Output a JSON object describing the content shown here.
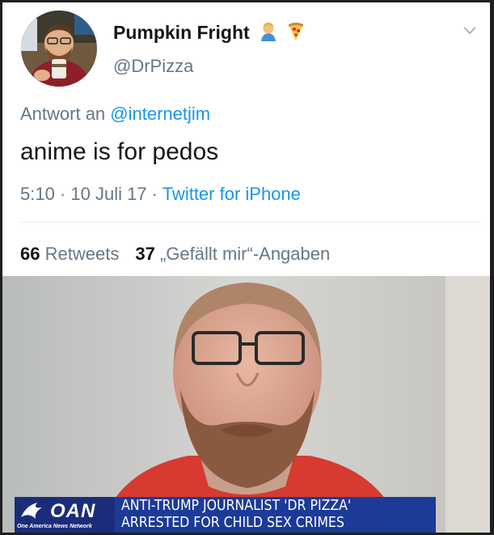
{
  "tweet": {
    "display_name": "Pumpkin Fright",
    "name_emojis": [
      "man-emoji",
      "pizza-emoji"
    ],
    "handle": "@DrPizza",
    "reply_prefix": "Antwort an",
    "reply_to": "@internetjim",
    "text": "anime is for pedos",
    "timestamp": "5:10 · 10 Juli 17 · ",
    "source": "Twitter for iPhone",
    "retweets_count": "66",
    "retweets_label": "Retweets",
    "likes_count": "37",
    "likes_label": "„Gefällt mir“-Angaben"
  },
  "news_ticker": {
    "logo_text": "OAN",
    "logo_subtext": "One America News Network",
    "headline_line1": "ANTI-TRUMP JOURNALIST 'DR PIZZA'",
    "headline_line2": "ARRESTED FOR CHILD SEX CRIMES"
  },
  "colors": {
    "link_blue": "#1b95e0",
    "muted_gray": "#657786",
    "ticker_blue": "#1c3b98",
    "shirt_red": "#d63a30"
  }
}
